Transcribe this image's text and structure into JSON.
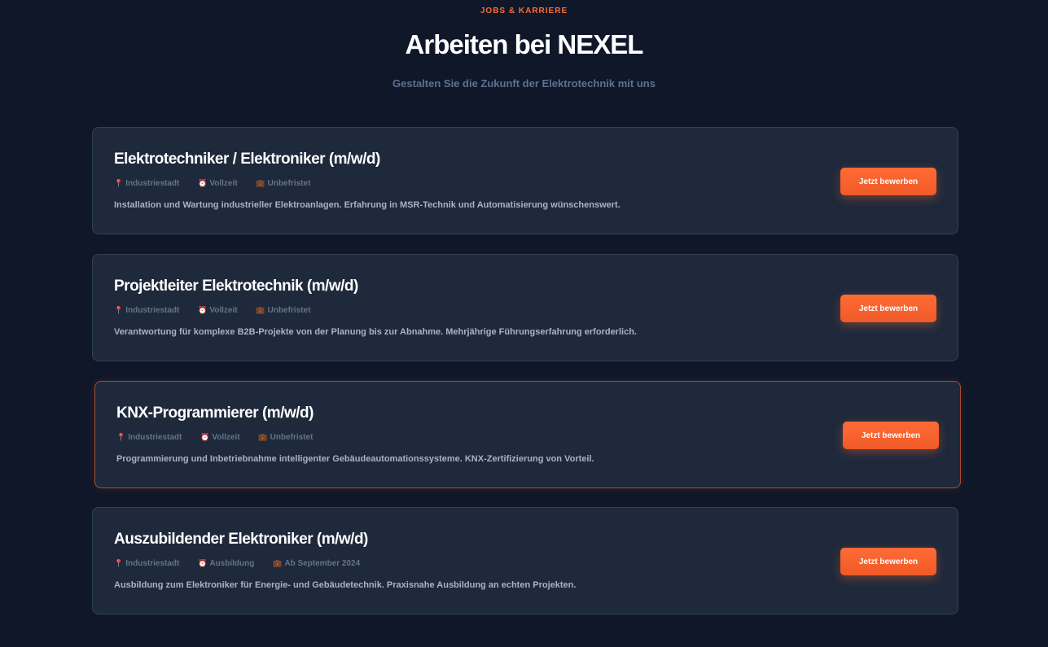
{
  "header": {
    "eyebrow": "JOBS & KARRIERE",
    "title": "Arbeiten bei NEXEL",
    "subtitle": "Gestalten Sie die Zukunft der Elektrotechnik mit uns"
  },
  "colors": {
    "background": "#0f1729",
    "card": "#1e293b",
    "accent": "#ff6b35"
  },
  "icons": {
    "location": "pin-icon",
    "type": "alarm-clock-icon",
    "duration": "briefcase-icon"
  },
  "jobs": [
    {
      "title": "Elektrotechniker / Elektroniker (m/w/d)",
      "location": "Industriestadt",
      "type": "Vollzeit",
      "duration": "Unbefristet",
      "description": "Installation und Wartung industrieller Elektroanlagen. Erfahrung in MSR-Technik und Automatisierung wünschenswert.",
      "button": "Jetzt bewerben"
    },
    {
      "title": "Projektleiter Elektrotechnik (m/w/d)",
      "location": "Industriestadt",
      "type": "Vollzeit",
      "duration": "Unbefristet",
      "description": "Verantwortung für komplexe B2B-Projekte von der Planung bis zur Abnahme. Mehrjährige Führungserfahrung erforderlich.",
      "button": "Jetzt bewerben"
    },
    {
      "title": "KNX-Programmierer (m/w/d)",
      "location": "Industriestadt",
      "type": "Vollzeit",
      "duration": "Unbefristet",
      "description": "Programmierung und Inbetriebnahme intelligenter Gebäudeautomationssysteme. KNX-Zertifizierung von Vorteil.",
      "button": "Jetzt bewerben"
    },
    {
      "title": "Auszubildender Elektroniker (m/w/d)",
      "location": "Industriestadt",
      "type": "Ausbildung",
      "duration": "Ab September 2024",
      "description": "Ausbildung zum Elektroniker für Energie- und Gebäudetechnik. Praxisnahe Ausbildung an echten Projekten.",
      "button": "Jetzt bewerben"
    }
  ]
}
